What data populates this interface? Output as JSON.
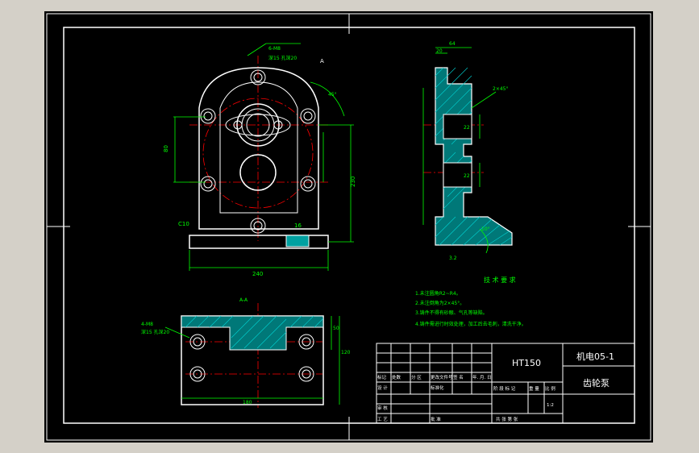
{
  "colors": {
    "background_window": "#d4d0c8",
    "drawing_bg": "#000000",
    "outline": "#ffffff",
    "dimension": "#00ff00",
    "centerline": "#ff0000",
    "hatch": "#00d0d0",
    "note_text": "#00ff00",
    "title_text": "#ffffff"
  },
  "title_block": {
    "material": "HT150",
    "drawing_no": "机电05-1",
    "part_name": "齿轮泵",
    "row_labels": [
      "标记",
      "处数",
      "分 区",
      "更改文件号",
      "签 名",
      "年. 月. 日"
    ],
    "design": "设 计",
    "standardize": "标准化",
    "stage_mark": "阶 段 标 记",
    "weight": "重 量",
    "scale": "比 例",
    "scale_value": "1:2",
    "review": "审 核",
    "process": "工 艺",
    "approve": "批 准",
    "sheets": "共   张 第   张"
  },
  "technical_requirements": {
    "heading": "技 术 要 求",
    "items": [
      "1.未注圆角R2~R4。",
      "2.未注倒角为2×45°。",
      "3.铸件不得有砂眼、气孔等缺陷。",
      "4.铸件需进行时效处理，加工后去毛刺，清洗干净。"
    ]
  },
  "dimensions": {
    "front_width": "240",
    "front_height": "230",
    "front_left": "80",
    "base_right": "16",
    "chamfer_c10": "C10",
    "hole_callout_top": "6-M8",
    "hole_callout_top2": "深15 孔深20",
    "angle_a": "45°",
    "bottom_width": "180",
    "bottom_h1": "50",
    "bottom_h2": "120",
    "bottom_callout": "4-M8",
    "bottom_callout2": "深15 孔深20",
    "side_top": "64",
    "side_small": "20",
    "side_chamfer": "2×45°",
    "side_d1": "22",
    "side_d2": "22",
    "roughness": "3.2",
    "section_label": "A-A",
    "section_mark": "A",
    "angle_side": "10°"
  }
}
